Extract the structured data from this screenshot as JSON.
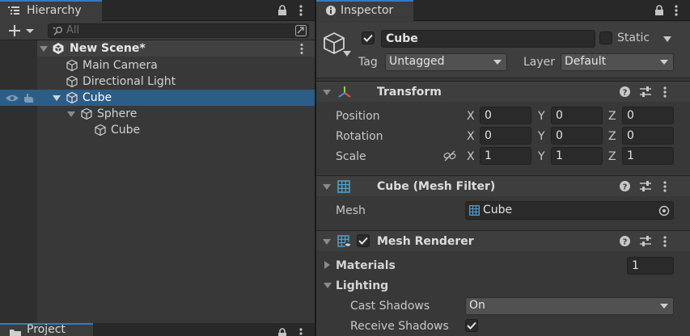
{
  "hierarchy": {
    "tab_label": "Hierarchy",
    "search_placeholder": "All",
    "scene_name": "New Scene*",
    "items": [
      {
        "label": "Main Camera",
        "selected": false
      },
      {
        "label": "Directional Light",
        "selected": false
      },
      {
        "label": "Cube",
        "selected": true,
        "expanded": true
      },
      {
        "label": "Sphere",
        "expanded": true
      },
      {
        "label": "Cube"
      }
    ]
  },
  "project": {
    "tab_label": "Project"
  },
  "inspector": {
    "tab_label": "Inspector",
    "object_name": "Cube",
    "active": true,
    "static_label": "Static",
    "static_checked": false,
    "tag_label": "Tag",
    "tag_value": "Untagged",
    "layer_label": "Layer",
    "layer_value": "Default",
    "transform": {
      "title": "Transform",
      "position_label": "Position",
      "rotation_label": "Rotation",
      "scale_label": "Scale",
      "axis_x": "X",
      "axis_y": "Y",
      "axis_z": "Z",
      "position": {
        "x": "0",
        "y": "0",
        "z": "0"
      },
      "rotation": {
        "x": "0",
        "y": "0",
        "z": "0"
      },
      "scale": {
        "x": "1",
        "y": "1",
        "z": "1"
      }
    },
    "mesh_filter": {
      "title": "Cube (Mesh Filter)",
      "mesh_label": "Mesh",
      "mesh_value": "Cube"
    },
    "mesh_renderer": {
      "title": "Mesh Renderer",
      "enabled": true,
      "materials_label": "Materials",
      "materials_count": "1",
      "lighting_label": "Lighting",
      "cast_shadows_label": "Cast Shadows",
      "cast_shadows_value": "On",
      "receive_shadows_label": "Receive Shadows",
      "receive_shadows_checked": true
    }
  },
  "colors": {
    "selection": "#2c5d87",
    "tab_accent": "#3a79bb",
    "panel_bg": "#383838"
  }
}
